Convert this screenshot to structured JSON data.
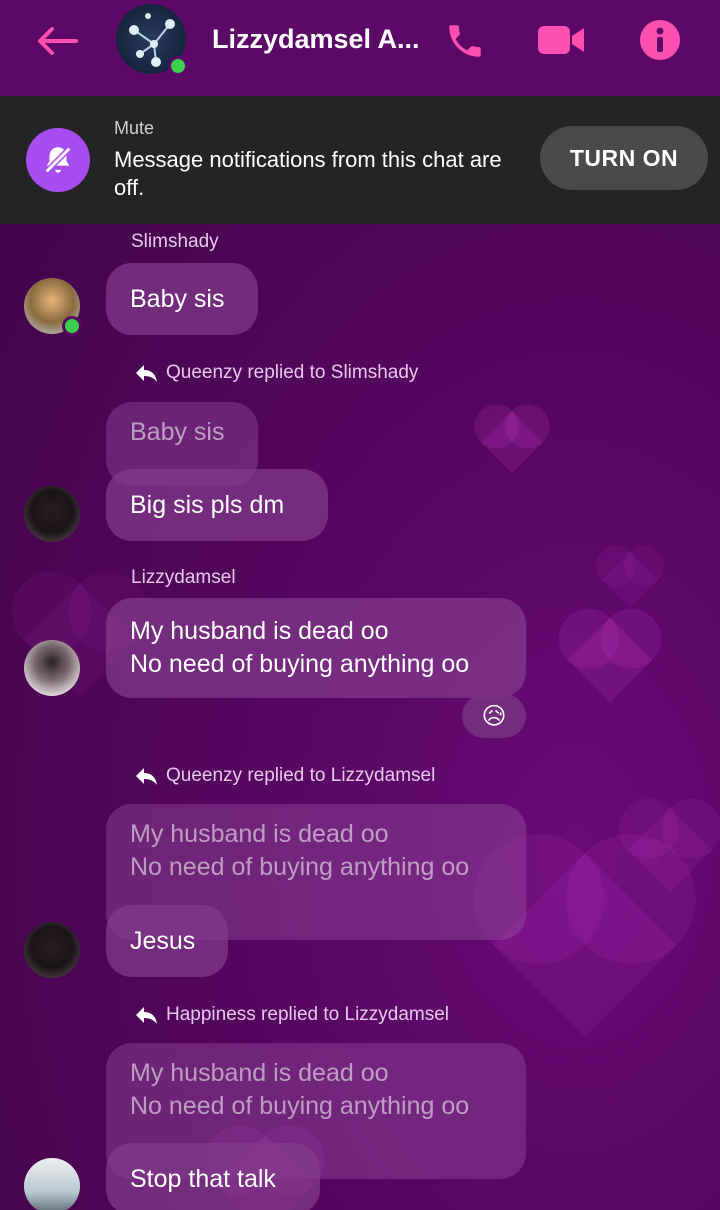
{
  "header": {
    "title": "Lizzydamsel A...",
    "accent_color": "#ff4fb0",
    "back_icon": "arrow-left-icon",
    "call_icon": "phone-icon",
    "video_icon": "video-camera-icon",
    "info_icon": "info-icon"
  },
  "mute_banner": {
    "label": "Mute",
    "text": "Message notifications from this chat are off.",
    "button_label": "TURN ON",
    "icon": "bell-off-icon"
  },
  "messages": {
    "m1": {
      "sender": "Slimshady",
      "text": "Baby sis"
    },
    "m2": {
      "reply_label": "Queenzy replied to Slimshady",
      "quoted": "Baby sis",
      "text": "Big sis pls dm"
    },
    "m3": {
      "sender": "Lizzydamsel",
      "line1": "My husband is dead oo",
      "line2": "No need of buying anything oo",
      "reaction": "😥"
    },
    "m4": {
      "reply_label": "Queenzy replied to Lizzydamsel",
      "quoted_line1": "My husband is dead oo",
      "quoted_line2": "No need of buying anything oo",
      "text": "Jesus"
    },
    "m5": {
      "reply_label": "Happiness replied to Lizzydamsel",
      "quoted_line1": "My husband is dead oo",
      "quoted_line2": "No need of buying anything oo",
      "text": "Stop that talk"
    }
  }
}
